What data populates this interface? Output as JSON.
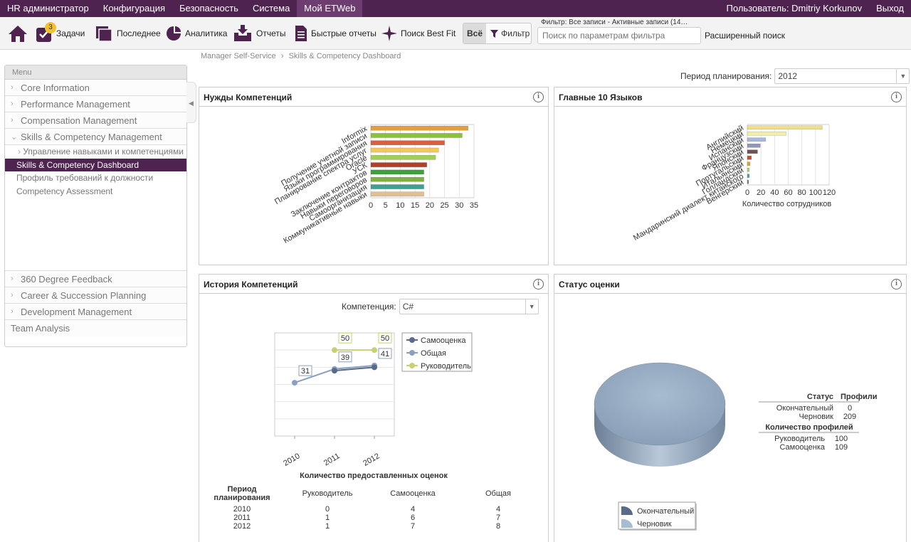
{
  "topbar": {
    "nav": [
      "HR администратор",
      "Конфигурация",
      "Безопасность",
      "Система",
      "Мой ETWeb"
    ],
    "active_index": 4,
    "user": "Пользователь: Dmitriy Korkunov",
    "logout": "Выход"
  },
  "toolbar": {
    "tasks_label": "Задачи",
    "tasks_badge": "3",
    "recent_label": "Последнее",
    "analytics_label": "Аналитика",
    "reports_label": "Отчеты",
    "quick_reports_label": "Быстрые отчеты",
    "bestfit_label": "Поиск Best Fit",
    "all_label": "Всё",
    "filter_label": "Фильтр",
    "filter_status": "Фильтр: Все записи - Активные записи (14…",
    "filter_placeholder": "Поиск по параметрам фильтра",
    "advanced_search": "Расширенный поиск"
  },
  "breadcrumb": {
    "parent": "Manager Self-Service",
    "current": "Skills & Competency Dashboard"
  },
  "sidebar": {
    "header": "Menu",
    "sections_top": [
      "Core Information",
      "Performance Management",
      "Compensation Management",
      "Skills & Competency Management"
    ],
    "sub_group": "Управление навыками и компетенциями",
    "active_item": "Skills & Competency Dashboard",
    "sub_items": [
      "Профиль требований к должности",
      "Competency Assessment"
    ],
    "sections_bottom": [
      "360 Degree Feedback",
      "Career & Succession Planning",
      "Development Management"
    ],
    "team_analysis": "Team Analysis"
  },
  "period": {
    "label": "Период планирования:",
    "value": "2012"
  },
  "panels": {
    "needs_title": "Нужды Компетенций",
    "languages_title": "Главные 10 Языков",
    "history_title": "История Компетенций",
    "status_title": "Статус оценки"
  },
  "chart_data": [
    {
      "type": "bar",
      "orientation": "horizontal",
      "title": "Нужды Компетенций",
      "categories": [
        "Informix",
        "Получение учетной записи",
        "Языки программирования",
        "Планирование спектра услуг",
        "Oracle",
        "УСК",
        "Заключение контрактов",
        "Навыки переговоров",
        "Самоорганизация",
        "Коммуникативные навыки"
      ],
      "values": [
        33,
        31,
        25,
        23,
        22,
        19,
        18,
        18,
        18,
        18
      ],
      "colors": [
        "#e0a040",
        "#8cc040",
        "#d86040",
        "#f0c860",
        "#a0d050",
        "#b04028",
        "#40a040",
        "#80b040",
        "#40a090",
        "#e0c090"
      ],
      "xticks": [
        0,
        5,
        10,
        15,
        20,
        25,
        30,
        35
      ],
      "xlim": [
        0,
        35
      ]
    },
    {
      "type": "bar",
      "orientation": "horizontal",
      "title": "Главные 10 Языков",
      "xlabel": "Количество сотрудников",
      "categories": [
        "Английский",
        "Немецкий",
        "Испанский",
        "Французский",
        "Японский",
        "Португальский",
        "Итальянский",
        "Голландский",
        "Мандаринский диалект китайского",
        "Венгерский"
      ],
      "values": [
        110,
        57,
        27,
        19,
        15,
        6,
        4,
        3,
        3,
        2
      ],
      "colors": [
        "#f0e080",
        "#f0f0a0",
        "#a8b8d8",
        "#9098b8",
        "#705050",
        "#c05030",
        "#e0a030",
        "#b0d070",
        "#50a0b0",
        "#708090"
      ],
      "xticks": [
        0,
        20,
        40,
        60,
        80,
        100,
        120
      ],
      "xlim": [
        0,
        120
      ]
    },
    {
      "type": "line",
      "title": "История Компетенций",
      "competency_label": "Компетенция:",
      "competency_value": "C#",
      "x": [
        "2010",
        "2011",
        "2012"
      ],
      "series": [
        {
          "name": "Самооценка",
          "color": "#5a6a8a",
          "values": [
            null,
            38,
            40
          ]
        },
        {
          "name": "Общая",
          "color": "#8aa0c0",
          "values": [
            31,
            39,
            41
          ]
        },
        {
          "name": "Руководитель",
          "color": "#c8d070",
          "values": [
            null,
            50,
            50
          ]
        }
      ],
      "data_labels": [
        {
          "series": "Общая",
          "x": "2010",
          "value": "31"
        },
        {
          "series": "Общая",
          "x": "2011",
          "value": "39"
        },
        {
          "series": "Общая",
          "x": "2012",
          "value": "41"
        },
        {
          "series": "Руководитель",
          "x": "2011",
          "value": "50"
        },
        {
          "series": "Руководитель",
          "x": "2012",
          "value": "50"
        }
      ],
      "ylim": [
        0,
        60
      ]
    },
    {
      "type": "table",
      "title": "Количество предоставленных оценок",
      "columns": [
        "Период планирования",
        "Руководитель",
        "Самооценка",
        "Общая"
      ],
      "rows": [
        [
          "2010",
          "0",
          "4",
          "4"
        ],
        [
          "2011",
          "1",
          "6",
          "7"
        ],
        [
          "2012",
          "1",
          "7",
          "8"
        ]
      ]
    },
    {
      "type": "pie",
      "title": "Статус оценки",
      "categories": [
        "Окончательный",
        "Черновик"
      ],
      "values": [
        0,
        209
      ],
      "colors": [
        "#5a6a8a",
        "#a8bcd0"
      ],
      "legend": "bottom",
      "table": {
        "status_header": "Статус",
        "profiles_header": "Профили",
        "status_rows": [
          [
            "Окончательный",
            "0"
          ],
          [
            "Черновик",
            "209"
          ]
        ],
        "count_header": "Количество профилей",
        "count_rows": [
          [
            "Руководитель",
            "100"
          ],
          [
            "Самооценка",
            "109"
          ]
        ]
      }
    }
  ]
}
